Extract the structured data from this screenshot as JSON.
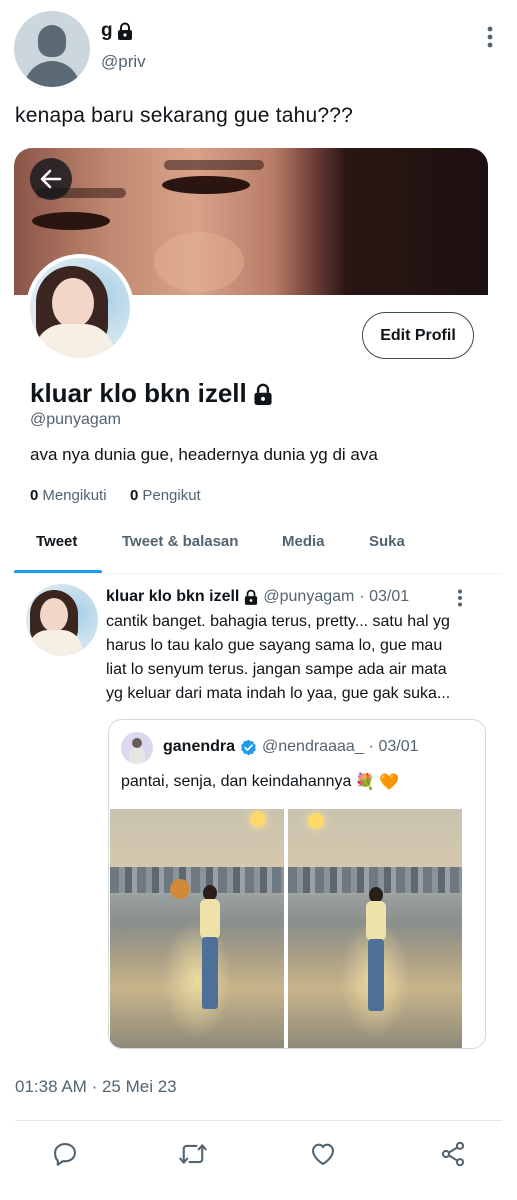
{
  "tweet": {
    "author_name": "g",
    "author_handle": "@priv",
    "text": "kenapa baru sekarang gue tahu???",
    "timestamp": "01:38 AM",
    "separator": "·",
    "date": "25 Mei 23",
    "actions": [
      "reply-icon",
      "retweet-icon",
      "like-icon",
      "share-icon"
    ]
  },
  "profile": {
    "name": "kluar klo bkn izell",
    "handle": "@punyagam",
    "bio": "ava nya dunia gue, headernya dunia yg di ava",
    "edit_button": "Edit Profil",
    "following_count": "0",
    "following_label": "Mengikuti",
    "followers_count": "0",
    "followers_label": "Pengikut",
    "tabs": [
      "Tweet",
      "Tweet & balasan",
      "Media",
      "Suka"
    ],
    "active_tab": "Tweet"
  },
  "inner_tweet": {
    "name": "kluar klo bkn izell",
    "handle": "@punyagam",
    "date": "· 03/01",
    "lines": [
      "cantik banget. bahagia terus, pretty... satu hal yg",
      "harus lo tau kalo gue sayang sama lo, gue mau",
      "liat lo senyum terus. jangan sampe ada air mata",
      "yg keluar dari mata indah lo yaa, gue gak suka..."
    ]
  },
  "quote": {
    "name": "ganendra",
    "handle": "@nendraaaa_",
    "date": "· 03/01",
    "text": "pantai, senja, dan keindahannya",
    "emojis": [
      "💐",
      "🧡"
    ]
  },
  "colors": {
    "accent": "#1d9bf0",
    "secondary_text": "#536471",
    "verified": "#1d9bf0"
  }
}
